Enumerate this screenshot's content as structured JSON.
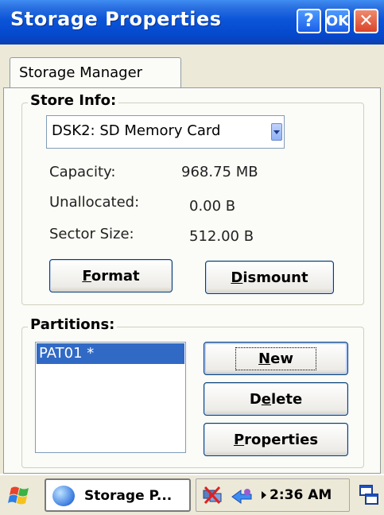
{
  "window": {
    "title": "Storage Properties",
    "help_label": "?",
    "ok_label": "OK",
    "close_label": "✕"
  },
  "tabs": [
    {
      "label": "Storage Manager",
      "active": true
    }
  ],
  "store_info": {
    "title": "Store Info:",
    "selected_store": "DSK2: SD Memory Card",
    "fields": [
      {
        "label": "Capacity:",
        "value": "968.75 MB"
      },
      {
        "label": "Unallocated:",
        "value": "0.00 B"
      },
      {
        "label": "Sector Size:",
        "value": "512.00 B"
      }
    ],
    "format_label": "Format",
    "format_mnemonic": "F",
    "format_rest": "ormat",
    "dismount_mnemonic": "D",
    "dismount_rest": "ismount"
  },
  "partitions": {
    "title": "Partitions:",
    "items": [
      "PAT01 *"
    ],
    "new_mnemonic": "N",
    "new_rest": "ew",
    "delete_pre": "D",
    "delete_mnemonic": "e",
    "delete_rest": "lete",
    "properties_mnemonic": "P",
    "properties_rest": "roperties"
  },
  "taskbar": {
    "task_label": "Storage P...",
    "clock": "2:36 AM"
  },
  "colors": {
    "titlebar": "#0a54d8",
    "selection": "#316ac5",
    "dialog_bg": "#ece9d8"
  }
}
